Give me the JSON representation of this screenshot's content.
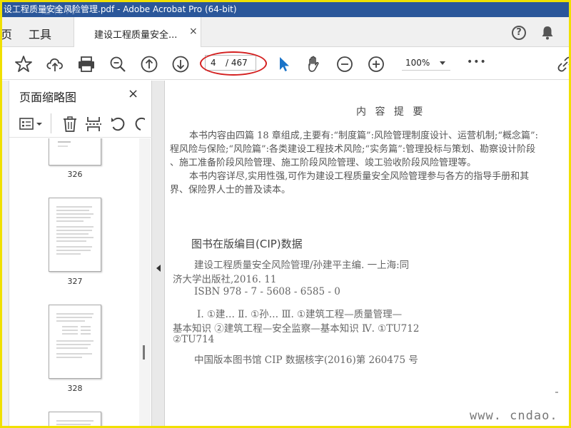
{
  "window": {
    "title": "设工程质量安全风险管理.pdf - Adobe Acrobat Pro (64-bit)",
    "watermark": "道 稀 网"
  },
  "tabs": {
    "home": "页",
    "tools": "工具",
    "document": "建设工程质量安全...",
    "close": "×"
  },
  "header_icons": [
    "help-icon",
    "bell-icon"
  ],
  "toolbar": {
    "icons": [
      "bookmark-star-icon",
      "cloud-upload-icon",
      "print-icon",
      "zoom-search-icon",
      "page-up-icon",
      "page-down-icon",
      "select-cursor-icon",
      "hand-tool-icon",
      "zoom-out-icon",
      "zoom-in-icon",
      "more-icon",
      "link-icon"
    ],
    "page_current": "4",
    "page_total": "/ 467",
    "zoom": "100%",
    "more": "•••",
    "highlight_color": "#d42020"
  },
  "sidepanel": {
    "title": "页面缩略图",
    "close": "×",
    "tool_icons": [
      "thumbnail-options-icon",
      "trash-icon",
      "extract-icon",
      "rotate-left-icon",
      "rotate-right-icon"
    ],
    "thumbnails": [
      {
        "label": "326"
      },
      {
        "label": "327"
      },
      {
        "label": "328"
      },
      {
        "label": ""
      }
    ]
  },
  "document": {
    "heading": "内 容 提 要",
    "summary_lines": [
      "本书内容由四篇 18 章组成,主要有:“制度篇”:风险管理制度设计、运营机制;“概念篇”:",
      "程风险与保险;“风险篇”:各类建设工程技术风险;“实务篇”:管理投标与策划、勘察设计阶段",
      "、施工准备阶段风险管理、施工阶段风险管理、竣工验收阶段风险管理等。",
      "本书内容详尽,实用性强,可作为建设工程质量安全风险管理参与各方的指导手册和其",
      "界、保险界人士的普及读本。"
    ],
    "cip_title": "图书在版编目(CIP)数据",
    "cip_lines": [
      "建设工程质量安全风险管理/孙建平主编. 一上海:同",
      "济大学出版社,2016. 11",
      "ISBN 978 - 7 - 5608 - 6585 - 0",
      "Ⅰ. ①建…   Ⅱ. ①孙…   Ⅲ. ①建筑工程—质量管理—",
      "基本知识 ②建筑工程—安全监察—基本知识   Ⅳ. ①TU712",
      "②TU714",
      "中国版本图书馆 CIP 数据核字(2016)第 260475 号"
    ],
    "site_watermark": "www. cndao. com"
  },
  "colors": {
    "title_bar": "#2b579a",
    "outer_border": "#f0e000",
    "accent_cursor": "#1a73c8"
  }
}
